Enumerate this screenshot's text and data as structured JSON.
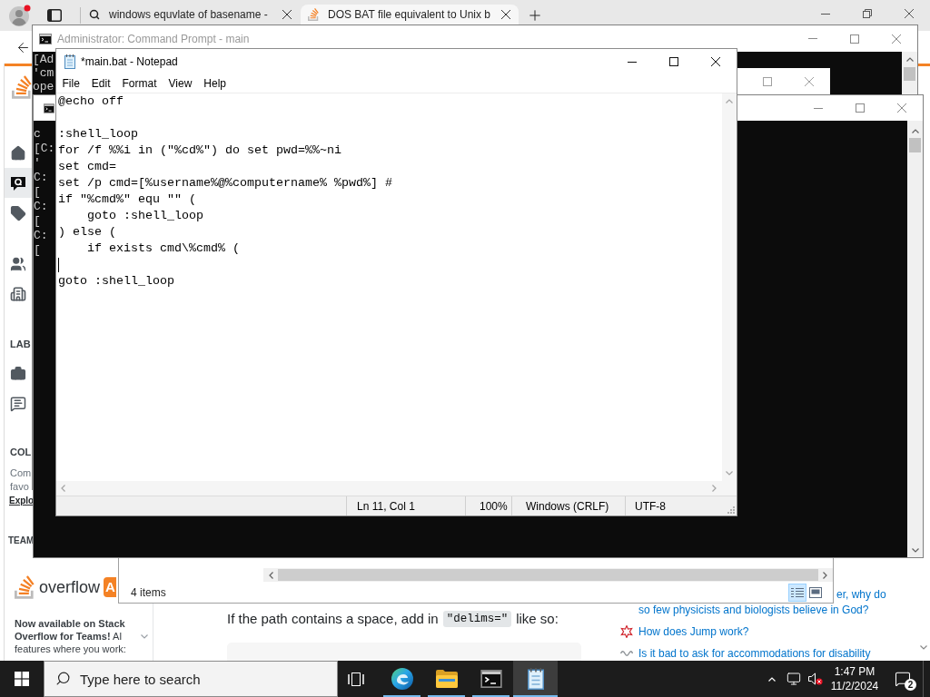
{
  "browser": {
    "tabs": [
      {
        "kind": "search",
        "title": "windows equvlate of basename -",
        "selected": false
      },
      {
        "kind": "site",
        "title": "DOS BAT file equivalent to Unix b",
        "selected": true
      }
    ]
  },
  "page": {
    "nav": [
      {
        "items": [
          {
            "kind": "home",
            "selected": false
          },
          {
            "kind": "questions",
            "selected": true
          },
          {
            "kind": "tags",
            "selected": false
          }
        ]
      },
      {
        "items": [
          {
            "kind": "users",
            "selected": false
          },
          {
            "kind": "companies",
            "selected": false
          }
        ]
      }
    ],
    "labs": {
      "heading": "LAB",
      "items": [
        {
          "kind": "jobs",
          "selected": false
        },
        {
          "kind": "discussions",
          "selected": false
        }
      ]
    },
    "collectives": {
      "heading": "COL",
      "lines": [
        "Com",
        "favo"
      ],
      "link": "Explo"
    },
    "teams": {
      "heading": "TEAM"
    },
    "promo": {
      "logo_text": "overflow",
      "logo_badge": "A",
      "text": "**Now available on Stack Overflow for Teams!** AI features where you work:"
    },
    "article": {
      "text_before": "If the path contains a space, add in",
      "code": "\"delims=\"",
      "text_after": "like so:"
    },
    "hot_questions": [
      {
        "kind": "continued",
        "lines": [
          "er, why do",
          "so few physicists and biologists believe in God?"
        ]
      },
      {
        "kind": "question",
        "lines": [
          "How does Jump work?"
        ]
      },
      {
        "kind": "question",
        "lines": [
          "Is it bad to ask for accommodations for disability"
        ]
      }
    ]
  },
  "terminals": [
    {
      "title": "Administrator: Command Prompt - main",
      "lines": [
        "[Ad",
        "'cm",
        "ope"
      ]
    },
    {
      "lines": [
        "c",
        "[C:",
        "'",
        "C:",
        "[",
        "C:",
        "[",
        "C:",
        "["
      ]
    }
  ],
  "notepad": {
    "title": "*main.bat - Notepad",
    "menu": [
      "File",
      "Edit",
      "Format",
      "View",
      "Help"
    ],
    "lines": [
      {
        "text": "@echo off",
        "cursor": false
      },
      {
        "cursor": false
      },
      {
        "text": ":shell_loop",
        "cursor": false
      },
      {
        "text": "for /f %%i in (\"%cd%\") do set pwd=%%~ni",
        "cursor": false
      },
      {
        "text": "set cmd=",
        "cursor": false
      },
      {
        "text": "set /p cmd=[%username%@%computername% %pwd%] #",
        "cursor": false
      },
      {
        "text": "if \"%cmd%\" equ \"\" (",
        "cursor": false
      },
      {
        "text": "\tgoto :shell_loop",
        "cursor": false
      },
      {
        "text": ") else (",
        "cursor": false
      },
      {
        "text": "\tif exists cmd\\%cmd% (",
        "cursor": false
      },
      {
        "cursor": true
      },
      {
        "text": "goto :shell_loop",
        "cursor": false
      }
    ],
    "status": [
      "Ln 11, Col 1",
      "100%",
      "Windows (CRLF)",
      "UTF-8"
    ]
  },
  "explorer": {
    "status": "4 items",
    "views": [
      {
        "kind": "details",
        "selected": true
      },
      {
        "kind": "large_icons",
        "selected": false
      }
    ]
  },
  "taskbar": {
    "search": {
      "placeholder": "Type here to search"
    },
    "apps": [
      {
        "kind": "edge",
        "open": true,
        "selected": false
      },
      {
        "kind": "explorer",
        "open": true,
        "selected": false
      },
      {
        "kind": "terminal",
        "open": true,
        "selected": false
      },
      {
        "kind": "notepad",
        "open": true,
        "selected": true
      }
    ],
    "tray": {
      "volume_muted": true
    },
    "time": "1:47 PM",
    "date": "11/2/2024",
    "notifications": "2"
  }
}
